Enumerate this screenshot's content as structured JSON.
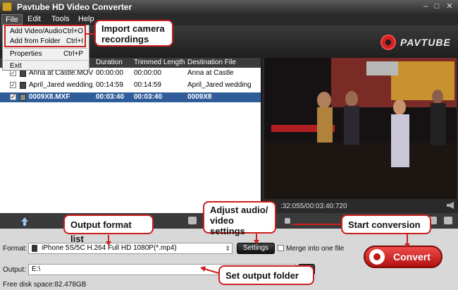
{
  "window": {
    "title": "Pavtube HD Video Converter"
  },
  "menu": [
    "File",
    "Edit",
    "Tools",
    "Help"
  ],
  "file_menu": [
    {
      "label": "Add Video/Audio",
      "shortcut": "Ctrl+O"
    },
    {
      "label": "Add from Folder",
      "shortcut": "Ctrl+I"
    },
    {
      "label": "Properties",
      "shortcut": "Ctrl+P"
    },
    {
      "label": "Exit",
      "shortcut": ""
    }
  ],
  "brand": "PAVTUBE",
  "file_list": {
    "columns": [
      "Duration",
      "Trimmed Length",
      "Destination File"
    ],
    "rows": [
      {
        "name": "Anna at Castle.MOV",
        "duration": "00:00:00",
        "trimmed": "00:00:00",
        "destination": "Anna at Castle",
        "checked": true,
        "selected": false
      },
      {
        "name": "April_Jared wedding...",
        "duration": "00:14:59",
        "trimmed": "00:14:59",
        "destination": "April_Jared wedding",
        "checked": true,
        "selected": false
      },
      {
        "name": "0009X8.MXF",
        "duration": "00:03:40",
        "trimmed": "00:03:40",
        "destination": "0009X8",
        "checked": true,
        "selected": true
      }
    ]
  },
  "preview": {
    "time": ":32:055/00:03:40:720"
  },
  "format": {
    "label": "Format:",
    "value": "iPhone 5S/5C H.264 Full HD 1080P(*.mp4)",
    "settings_label": "Settings",
    "merge_label": "Merge into one file"
  },
  "output": {
    "label": "Output:",
    "value": "E:\\"
  },
  "free_disk": "Free disk space:82.478GB",
  "convert_label": "Convert",
  "callouts": {
    "import": "Import camera recordings",
    "format_list": "Output format list",
    "adjust": "Adjust audio/ video settings",
    "start": "Start conversion",
    "output_folder": "Set output folder"
  },
  "colors": {
    "accent": "#cc1f1f",
    "selected_row": "#2f5d9a",
    "convert": "#d42020"
  }
}
